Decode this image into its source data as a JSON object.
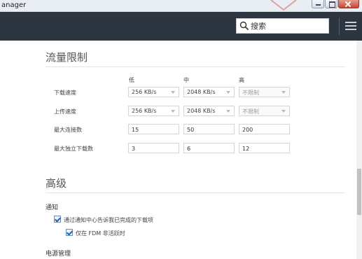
{
  "window": {
    "title": "anager"
  },
  "header": {
    "search_placeholder": "搜索"
  },
  "traffic": {
    "title": "流量限制",
    "columns": [
      "低",
      "中",
      "高"
    ],
    "rows": [
      {
        "label": "下载速度",
        "values": [
          "256 KB/s",
          "2048 KB/s",
          "不限制"
        ]
      },
      {
        "label": "上传速度",
        "values": [
          "256 KB/s",
          "2048 KB/s",
          "不限制"
        ]
      },
      {
        "label": "最大连接数",
        "values": [
          "15",
          "50",
          "200"
        ]
      },
      {
        "label": "最大独立下载数",
        "values": [
          "3",
          "6",
          "12"
        ]
      }
    ]
  },
  "advanced": {
    "title": "高级",
    "notify_heading": "通知",
    "notify_option": "通过通知中心告诉我已完成的下载项",
    "notify_sub_option": "仅在 FDM 非活跃时",
    "power_heading": "电源管理"
  },
  "colors": {
    "header_bg": "#2d3540",
    "accent": "#2a5fab"
  },
  "scrollbar": {
    "position": 0.62
  }
}
